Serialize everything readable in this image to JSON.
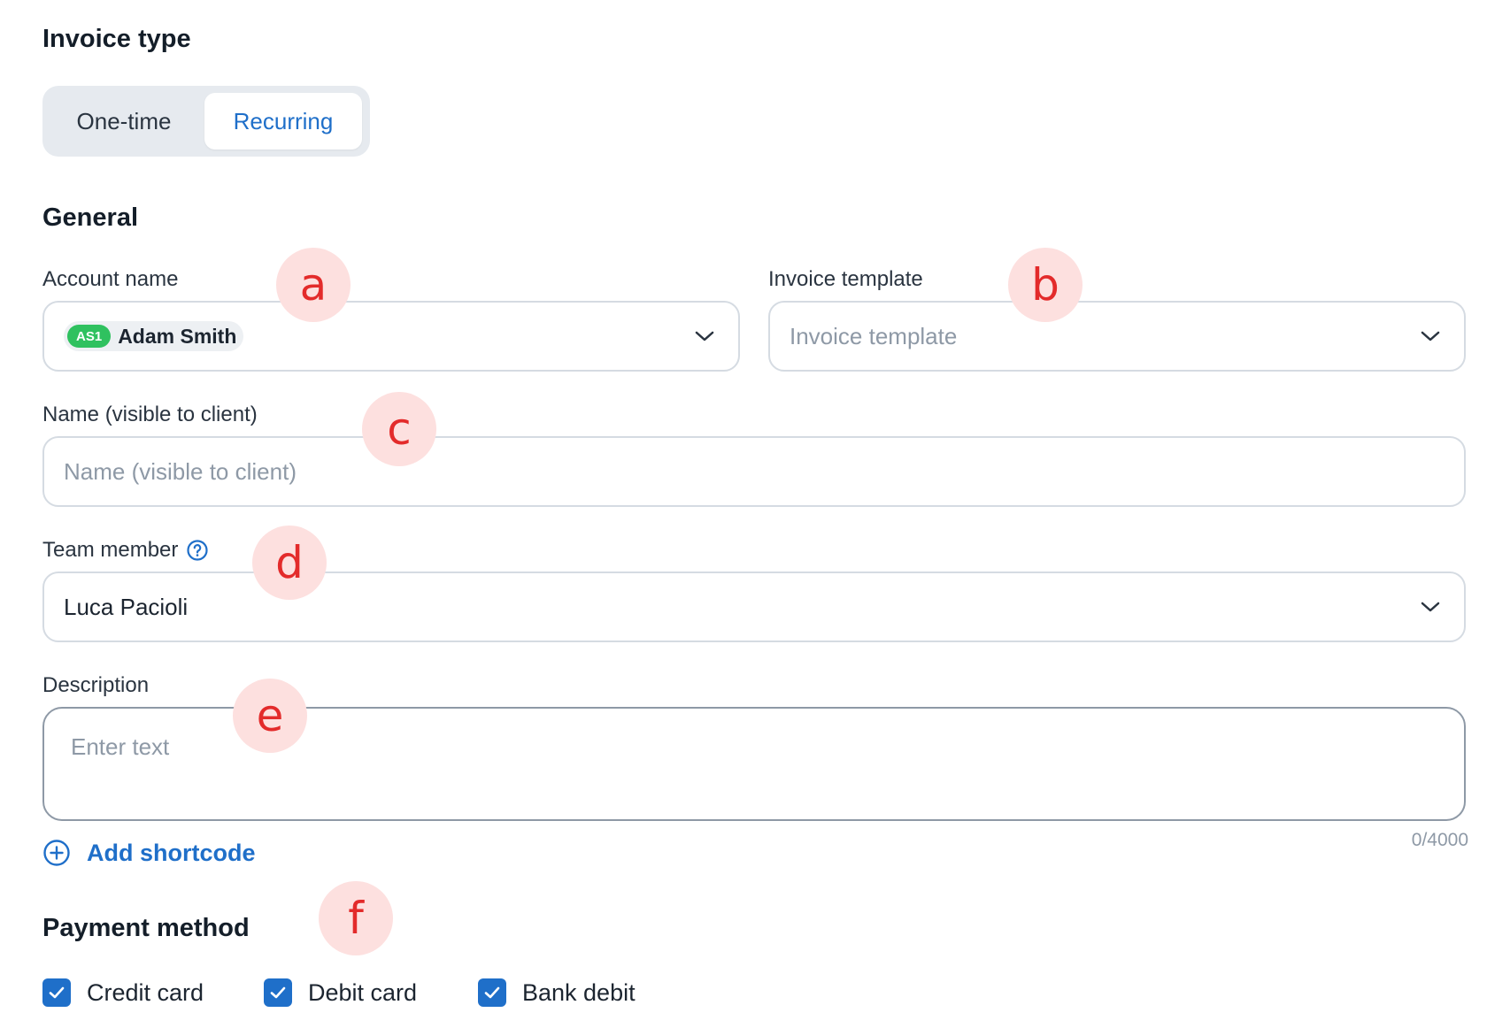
{
  "invoice_type": {
    "title": "Invoice type",
    "options": [
      "One-time",
      "Recurring"
    ],
    "selected": "Recurring"
  },
  "general": {
    "title": "General",
    "account_name": {
      "label": "Account name",
      "badge": "AS1",
      "value": "Adam Smith"
    },
    "invoice_template": {
      "label": "Invoice template",
      "placeholder": "Invoice template"
    },
    "name": {
      "label": "Name (visible to client)",
      "placeholder": "Name (visible to client)"
    },
    "team_member": {
      "label": "Team member",
      "value": "Luca Pacioli"
    },
    "description": {
      "label": "Description",
      "placeholder": "Enter text",
      "counter": "0/4000"
    },
    "add_shortcode": "Add shortcode"
  },
  "payment_method": {
    "title": "Payment method",
    "options": [
      {
        "label": "Credit card",
        "checked": true
      },
      {
        "label": "Debit card",
        "checked": true
      },
      {
        "label": "Bank debit",
        "checked": true
      }
    ]
  },
  "markers": [
    "a",
    "b",
    "c",
    "d",
    "e",
    "f"
  ],
  "colors": {
    "accent": "#1f6fc9",
    "badge_green": "#2fc15f",
    "marker_bg": "#fde0df",
    "marker_text": "#e32b2b"
  }
}
